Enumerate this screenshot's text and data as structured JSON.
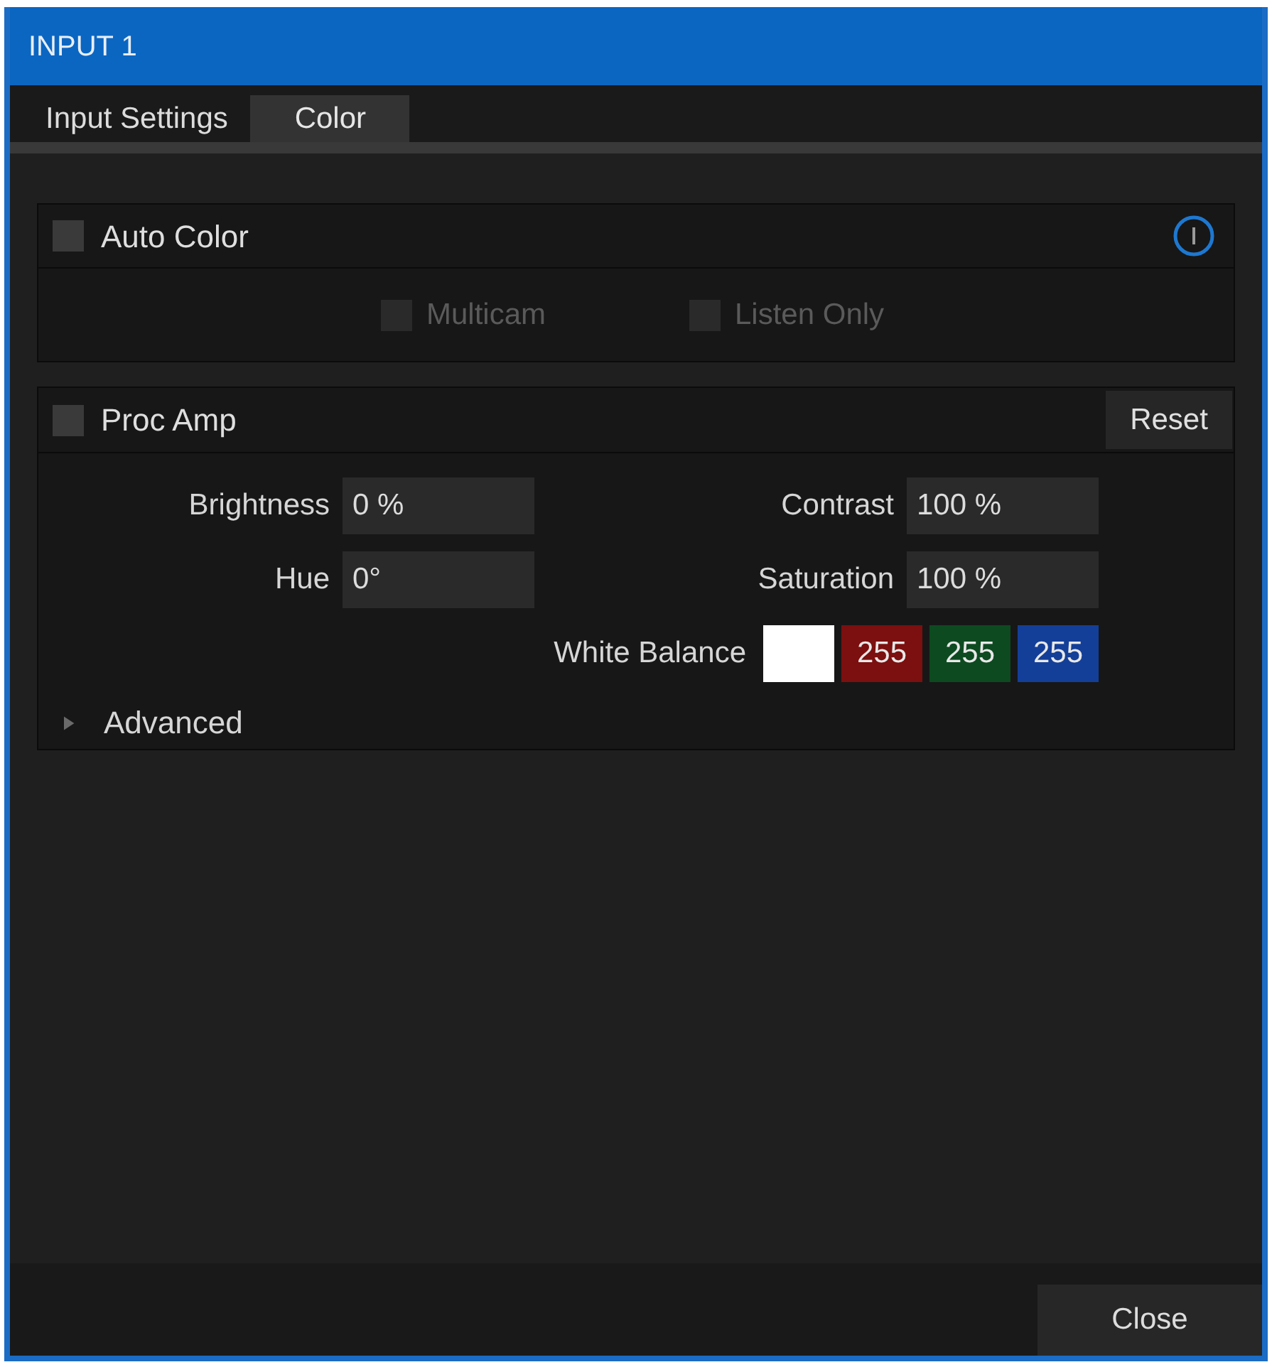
{
  "window": {
    "title": "INPUT 1"
  },
  "tabs": [
    {
      "label": "Input Settings",
      "selected": false
    },
    {
      "label": "Color",
      "selected": true
    }
  ],
  "auto_color": {
    "label": "Auto Color",
    "checked": false,
    "options": [
      {
        "label": "Multicam",
        "checked": false,
        "disabled": true
      },
      {
        "label": "Listen Only",
        "checked": false,
        "disabled": true
      }
    ]
  },
  "proc_amp": {
    "label": "Proc Amp",
    "checked": false,
    "reset_button": "Reset",
    "rows": [
      [
        {
          "label": "Brightness",
          "value": "0 %"
        },
        {
          "label": "Contrast",
          "value": "100 %"
        }
      ],
      [
        {
          "label": "Hue",
          "value": "0°"
        },
        {
          "label": "Saturation",
          "value": "100 %"
        }
      ]
    ],
    "white_balance": {
      "label": "White Balance",
      "swatch": {
        "color": "#ffffff"
      },
      "channels": [
        {
          "value": "255",
          "color": "#7c0f0f"
        },
        {
          "value": "255",
          "color": "#0d4a20"
        },
        {
          "value": "255",
          "color": "#143f98"
        }
      ]
    },
    "advanced": {
      "label": "Advanced",
      "expanded": false
    }
  },
  "buttons": [
    "Close"
  ]
}
